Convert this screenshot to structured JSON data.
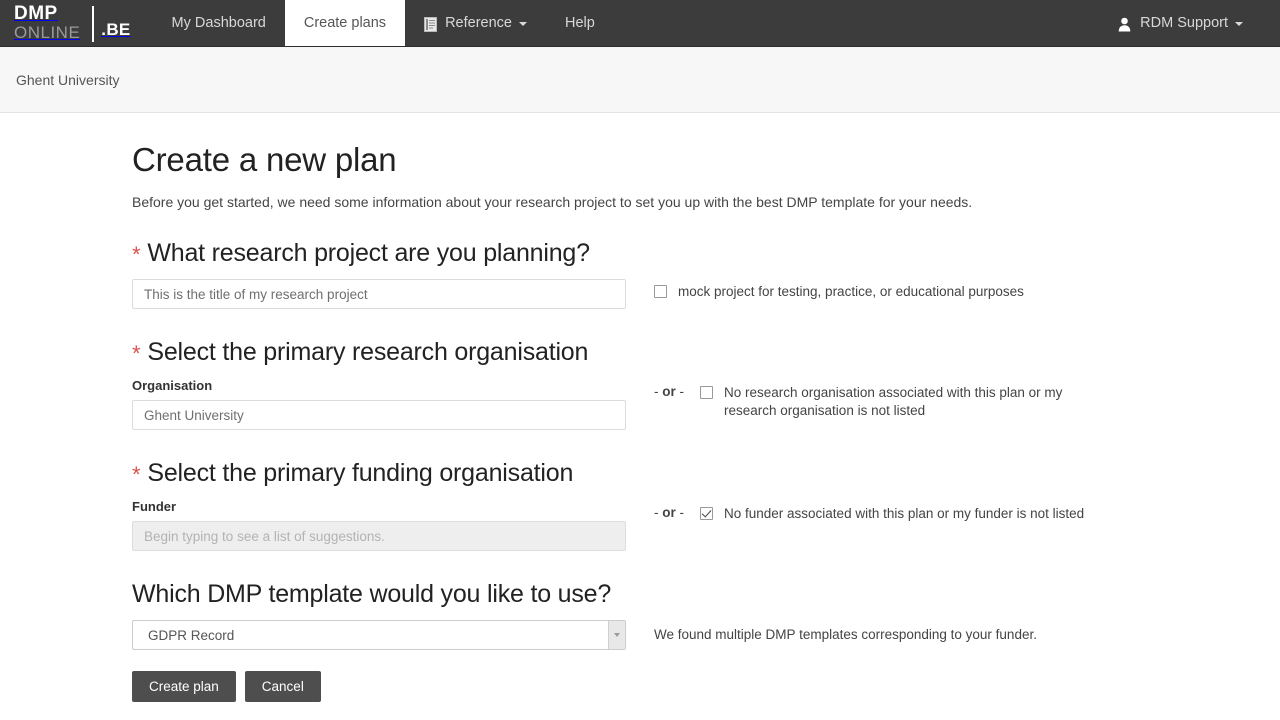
{
  "navbar": {
    "brand": {
      "dmp": "DMP",
      "online": "ONLINE",
      "be": ".BE"
    },
    "items": [
      {
        "label": "My Dashboard",
        "active": false,
        "icon": null,
        "caret": false
      },
      {
        "label": "Create plans",
        "active": true,
        "icon": null,
        "caret": false
      },
      {
        "label": "Reference",
        "active": false,
        "icon": "book-icon",
        "caret": true
      },
      {
        "label": "Help",
        "active": false,
        "icon": null,
        "caret": false
      }
    ],
    "user": {
      "label": "RDM Support",
      "icon": "user-icon",
      "caret": true
    }
  },
  "breadcrumb": {
    "items": [
      "Ghent University"
    ]
  },
  "page": {
    "title": "Create a new plan",
    "intro": "Before you get started, we need some information about your research project to set you up with the best DMP template for your needs."
  },
  "sections": {
    "project": {
      "required_marker": "*",
      "heading": "What research project are you planning?",
      "input_value": "This is the title of my research project",
      "input_placeholder": "This is the title of my research project",
      "checkbox_label": "mock project for testing, practice, or educational purposes",
      "checkbox_checked": false
    },
    "organisation": {
      "required_marker": "*",
      "heading": "Select the primary research organisation",
      "field_label": "Organisation",
      "input_value": "Ghent University",
      "input_placeholder": "Begin typing to see a list of suggestions.",
      "or_text": "- or -",
      "checkbox_label": "No research organisation associated with this plan or my research organisation is not listed",
      "checkbox_checked": false
    },
    "funder": {
      "required_marker": "*",
      "heading": "Select the primary funding organisation",
      "field_label": "Funder",
      "input_value": "",
      "input_placeholder": "Begin typing to see a list of suggestions.",
      "input_disabled": true,
      "or_text": "- or -",
      "checkbox_label": "No funder associated with this plan or my funder is not listed",
      "checkbox_checked": true
    },
    "template": {
      "heading": "Which DMP template would you like to use?",
      "selected": "GDPR Record",
      "options": [
        "GDPR Record"
      ],
      "helper_text": "We found multiple DMP templates corresponding to your funder."
    }
  },
  "actions": {
    "create_label": "Create plan",
    "cancel_label": "Cancel"
  },
  "colors": {
    "navbar_bg": "#3c3c3c",
    "required_red": "#d9534f",
    "button_bg": "#4e4e4e",
    "breadcrumb_bg": "#f7f7f7"
  }
}
